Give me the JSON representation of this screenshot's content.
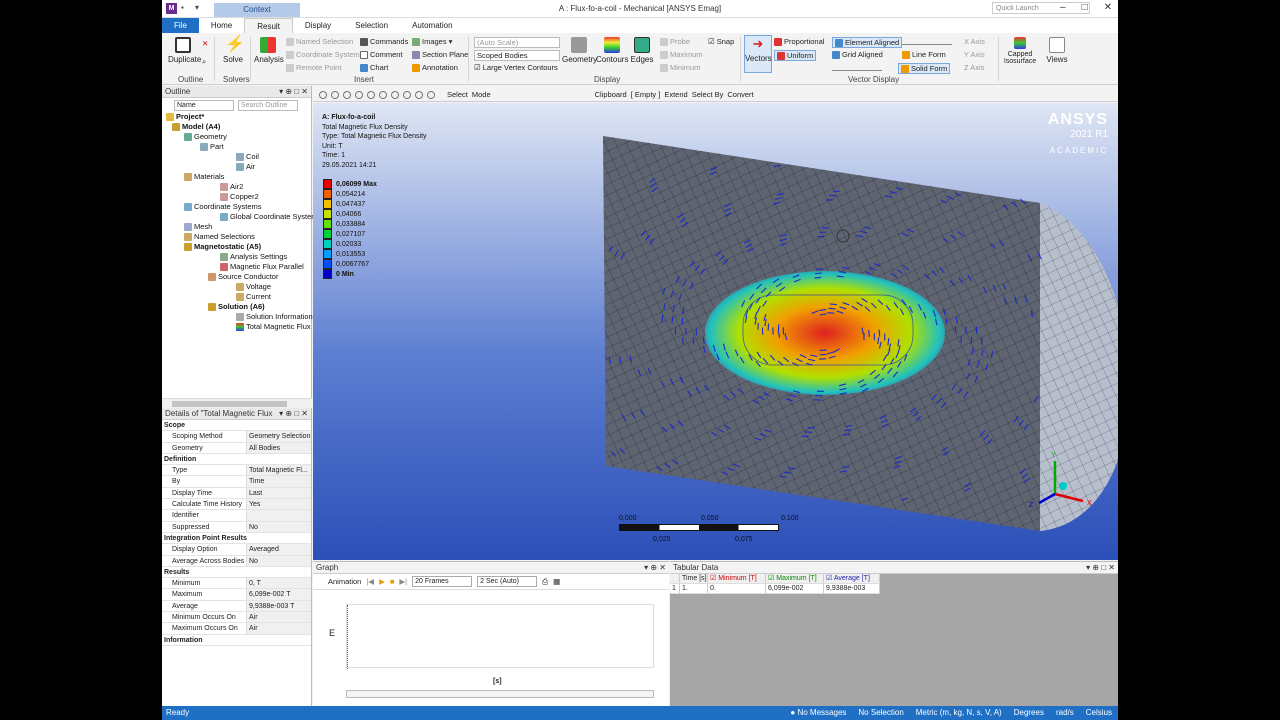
{
  "window": {
    "title": "A : Flux-fo-a-coil - Mechanical [ANSYS Emag]",
    "context_tab": "Context",
    "quick_launch_placeholder": "Quick Launch"
  },
  "tabs": [
    "File",
    "Home",
    "Result",
    "Display",
    "Selection",
    "Automation"
  ],
  "ribbon": {
    "duplicate": "Duplicate",
    "solve": "Solve",
    "analysis": "Analysis",
    "named_selection": "Named Selection",
    "coordinate_system": "Coordinate System",
    "remote_point": "Remote Point",
    "commands": "Commands",
    "comment": "Comment",
    "chart": "Chart",
    "images": "Images",
    "section_plane": "Section Plane",
    "annotation": "Annotation",
    "scale": "(Auto Scale)",
    "scoped_bodies": "Scoped Bodies",
    "large_vertex_contours": "Large Vertex Contours",
    "geometry": "Geometry",
    "contours": "Contours",
    "edges": "Edges",
    "probe": "Probe",
    "maximum": "Maximum",
    "minimum": "Minimum",
    "snap": "Snap",
    "vectors": "Vectors",
    "proportional": "Proportional",
    "uniform": "Uniform",
    "element_aligned": "Element Aligned",
    "grid_aligned": "Grid Aligned",
    "line_form": "Line Form",
    "solid_form": "Solid Form",
    "x_axis": "X Axis",
    "y_axis": "Y Axis",
    "z_axis": "Z Axis",
    "capped_isosurface": "Capped Isosurface",
    "views": "Views",
    "groups": {
      "outline": "Outline",
      "solvers": "Solvers",
      "insert": "Insert",
      "display": "Display",
      "vector_display": "Vector Display"
    }
  },
  "outline": {
    "title": "Outline",
    "filter": "Name",
    "search": "Search Outline",
    "items": [
      "Project*",
      "Model (A4)",
      "Geometry",
      "Part",
      "Coil",
      "Air",
      "Materials",
      "Air2",
      "Copper2",
      "Coordinate Systems",
      "Global Coordinate System",
      "Mesh",
      "Named Selections",
      "Magnetostatic (A5)",
      "Analysis Settings",
      "Magnetic Flux Parallel",
      "Source Conductor",
      "Voltage",
      "Current",
      "Solution (A6)",
      "Solution Information",
      "Total Magnetic Flux D"
    ]
  },
  "details": {
    "title": "Details of \"Total Magnetic Flux",
    "rows": [
      {
        "k": "Scope",
        "sec": true
      },
      {
        "k": "Scoping Method",
        "v": "Geometry Selection"
      },
      {
        "k": "Geometry",
        "v": "All Bodies"
      },
      {
        "k": "Definition",
        "sec": true
      },
      {
        "k": "Type",
        "v": "Total Magnetic Fl..."
      },
      {
        "k": "By",
        "v": "Time"
      },
      {
        "k": "Display Time",
        "v": "Last"
      },
      {
        "k": "Calculate Time History",
        "v": "Yes"
      },
      {
        "k": "Identifier",
        "v": ""
      },
      {
        "k": "Suppressed",
        "v": "No"
      },
      {
        "k": "Integration Point Results",
        "sec": true
      },
      {
        "k": "Display Option",
        "v": "Averaged"
      },
      {
        "k": "Average Across Bodies",
        "v": "No"
      },
      {
        "k": "Results",
        "sec": true
      },
      {
        "k": "Minimum",
        "v": "0, T"
      },
      {
        "k": "Maximum",
        "v": "6,099e-002 T"
      },
      {
        "k": "Average",
        "v": "9,9388e-003 T"
      },
      {
        "k": "Minimum Occurs On",
        "v": "Air"
      },
      {
        "k": "Maximum Occurs On",
        "v": "Air"
      },
      {
        "k": "Information",
        "sec": true
      }
    ]
  },
  "viewtool": {
    "select": "Select",
    "mode": "Mode",
    "clipboard": "Clipboard",
    "empty": "[ Empty ]",
    "extend": "Extend",
    "select_by": "Select By",
    "convert": "Convert"
  },
  "viewport": {
    "name": "A: Flux-fo-a-coil",
    "type_line": "Total Magnetic Flux Density",
    "type": "Type: Total Magnetic Flux Density",
    "unit": "Unit: T",
    "time": "Time: 1",
    "date": "29.05.2021 14:21",
    "legend": [
      {
        "label": "0,06099 Max",
        "color": "#e60000"
      },
      {
        "label": "0,054214",
        "color": "#f06000"
      },
      {
        "label": "0,047437",
        "color": "#f0c000"
      },
      {
        "label": "0,04066",
        "color": "#c8e000"
      },
      {
        "label": "0,033884",
        "color": "#60e000"
      },
      {
        "label": "0,027107",
        "color": "#00d040"
      },
      {
        "label": "0,02033",
        "color": "#00d0c0"
      },
      {
        "label": "0,013553",
        "color": "#00a0ff"
      },
      {
        "label": "0,0067767",
        "color": "#0050ff"
      },
      {
        "label": "0 Min",
        "color": "#0000c8"
      }
    ],
    "brand": "ANSYS",
    "release": "2021 R1",
    "edition": "ACADEMIC",
    "scale": {
      "l0": "0,000",
      "l1": "0,050",
      "l2": "0,100",
      "l3": "0,025",
      "l4": "0,075"
    }
  },
  "graph": {
    "title": "Graph",
    "animation": "Animation",
    "frames": "20 Frames",
    "duration": "2 Sec (Auto)",
    "ylabel": "E",
    "xlabel": "[s]"
  },
  "tabular": {
    "title": "Tabular Data",
    "headers": [
      "Time [s]",
      "Minimum [T]",
      "Maximum [T]",
      "Average [T]"
    ],
    "row": [
      "1",
      "1.",
      "0.",
      "6,099e-002",
      "9,9388e-003"
    ]
  },
  "status": {
    "ready": "Ready",
    "messages": "No Messages",
    "selection": "No Selection",
    "units": "Metric (m, kg, N, s, V, A)",
    "degrees": "Degrees",
    "rad": "rad/s",
    "temp": "Celsius"
  }
}
